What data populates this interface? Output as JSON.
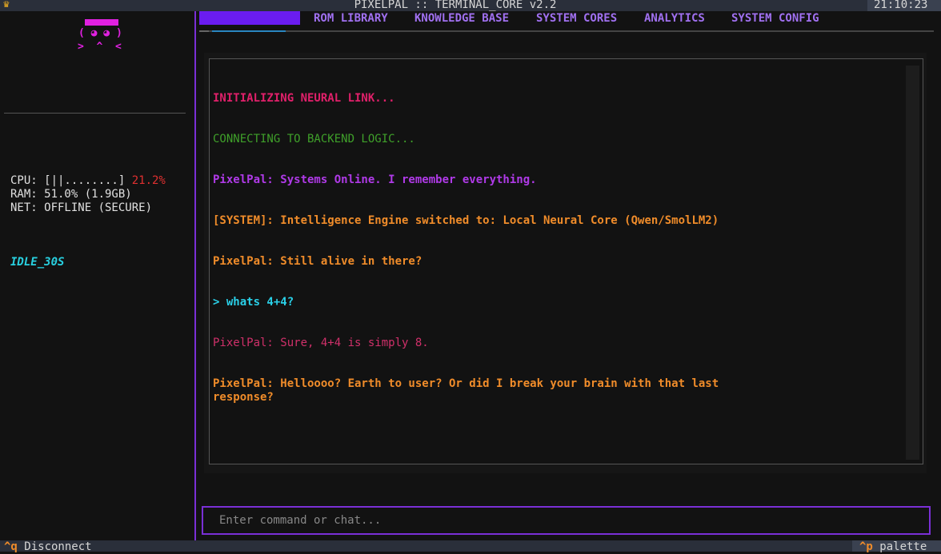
{
  "window": {
    "title": "PIXELPAL :: TERMINAL_CORE v2.2",
    "clock": "21:10:23",
    "crown_icon": "crown-icon"
  },
  "sidebar": {
    "mascot": {
      "face": "( ◕ ◕ )",
      "mouth": ">  ^  <"
    },
    "stats": {
      "cpu_label": "CPU: [||........] ",
      "cpu_pct": "21.2%",
      "ram": "RAM: 51.0% (1.9GB)",
      "net": "NET: OFFLINE (SECURE)"
    },
    "status": "IDLE_30S"
  },
  "tabs": [
    {
      "label": "",
      "active": true
    },
    {
      "label": "ROM LIBRARY"
    },
    {
      "label": "KNOWLEDGE BASE"
    },
    {
      "label": "SYSTEM CORES"
    },
    {
      "label": "ANALYTICS"
    },
    {
      "label": "SYSTEM CONFIG"
    }
  ],
  "chat": {
    "lines": [
      {
        "text": "INITIALIZING NEURAL LINK...",
        "kind": "init"
      },
      {
        "text": "CONNECTING TO BACKEND LOGIC...",
        "kind": "connect"
      },
      {
        "text": "PixelPal: Systems Online. I remember everything.",
        "kind": "pal"
      },
      {
        "text": "[SYSTEM]: Intelligence Engine switched to: Local Neural Core (Qwen/SmolLM2)",
        "kind": "sys"
      },
      {
        "text": "PixelPal: Still alive in there?",
        "kind": "sys"
      },
      {
        "text": "> whats 4+4?",
        "kind": "user"
      },
      {
        "text": "PixelPal: Sure, 4+4 is simply 8.",
        "kind": "red"
      },
      {
        "text": "PixelPal: Helloooo? Earth to user? Or did I break your brain with that last\nresponse?",
        "kind": "sys"
      }
    ]
  },
  "input": {
    "placeholder": "Enter command or chat..."
  },
  "footer": {
    "disconnect_key": "^q",
    "disconnect_label": " Disconnect",
    "palette_key": "^p",
    "palette_label": " palette"
  },
  "colors": {
    "accent": "#7a2fd6",
    "active_tab": "#6a1cf0",
    "mascot": "#e020e0",
    "orange": "#f08c2a",
    "cyan": "#2ad0e8"
  }
}
